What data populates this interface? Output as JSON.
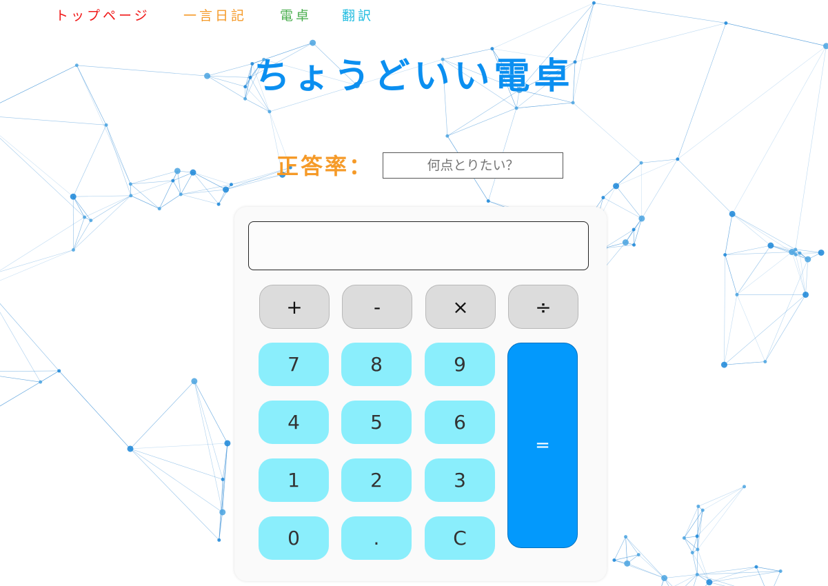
{
  "nav": {
    "items": [
      {
        "label": "トップページ",
        "color": "#f01818"
      },
      {
        "label": "一言日記",
        "color": "#f59a28"
      },
      {
        "label": "電卓",
        "color": "#4caf50"
      },
      {
        "label": "翻訳",
        "color": "#20bce0"
      }
    ]
  },
  "page": {
    "title": "ちょうどいい電卓",
    "title_color": "#0b8ff0"
  },
  "accuracy": {
    "label": "正答率：",
    "label_color": "#f59a28",
    "input_value": "",
    "input_placeholder": "何点とりたい？",
    "placeholder_color": "#f59a28"
  },
  "calculator": {
    "display_value": "",
    "operators": [
      "+",
      "-",
      "×",
      "÷"
    ],
    "digits": [
      [
        "7",
        "8",
        "9"
      ],
      [
        "4",
        "5",
        "6"
      ],
      [
        "1",
        "2",
        "3"
      ],
      [
        "0",
        ".",
        "C"
      ]
    ],
    "equals_label": "=",
    "colors": {
      "operator_bg": "#dcdcdc",
      "digit_bg": "#8aeefc",
      "equals_bg": "#0399fc"
    }
  },
  "background": {
    "description_icon": "network-graph-pattern",
    "line_color": "#3a8fd6"
  }
}
